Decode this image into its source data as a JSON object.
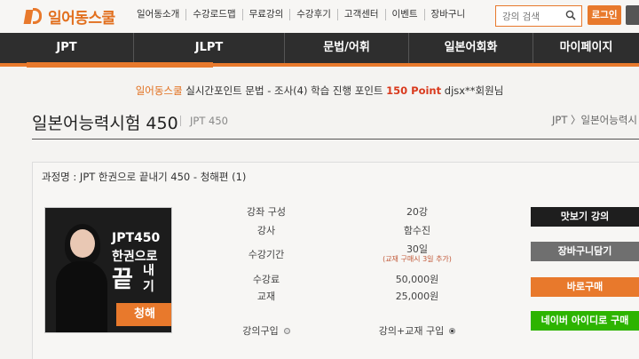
{
  "brand": {
    "logo_text": "일어동스쿨"
  },
  "top_nav": [
    "일어동소개",
    "수강로드맵",
    "무료강의",
    "수강후기",
    "고객센터",
    "이벤트",
    "장바구니"
  ],
  "search": {
    "placeholder": "강의 검색"
  },
  "login_label": "로그인",
  "main_nav": [
    "JPT",
    "JLPT",
    "문법/어휘",
    "일본어회화",
    "마이페이지"
  ],
  "ticker": {
    "brand": "일어동스쿨",
    "text": " 실시간포인트 문법 - 조사(4) 학습 진행 포인트 ",
    "points": "150 Point",
    "user": " djsx**회원님"
  },
  "page": {
    "title": "일본어능력시험 450",
    "subtitle": "JPT 450",
    "breadcrumb": "JPT 〉일본어능력시"
  },
  "course": {
    "name": "과정명 : JPT 한권으로 끝내기 450 - 청해편 (1)",
    "thumbnail": {
      "line1": "JPT450",
      "line2": "한권으로",
      "line3": "끝",
      "line4": "내기",
      "badge": "청해"
    },
    "info": [
      {
        "label": "강좌 구성",
        "value": "20강"
      },
      {
        "label": "강사",
        "value": "함수진"
      },
      {
        "label": "수강기간",
        "value": "30일",
        "note": "(교재 구매시 3일 추가)"
      },
      {
        "label": "수강료",
        "value": "50,000원"
      },
      {
        "label": "교재",
        "value": "25,000원"
      }
    ],
    "options": {
      "lecture_only": "강의구입",
      "lecture_book": "강의+교재 구입"
    }
  },
  "buttons": {
    "sample": "맛보기 강의",
    "cart": "장바구니담기",
    "buy": "바로구매",
    "naver": "네이버 아이디로 구매"
  },
  "colors": {
    "accent": "#e8792c",
    "nav_bg": "#2e2e2e",
    "naver": "#2db400"
  }
}
